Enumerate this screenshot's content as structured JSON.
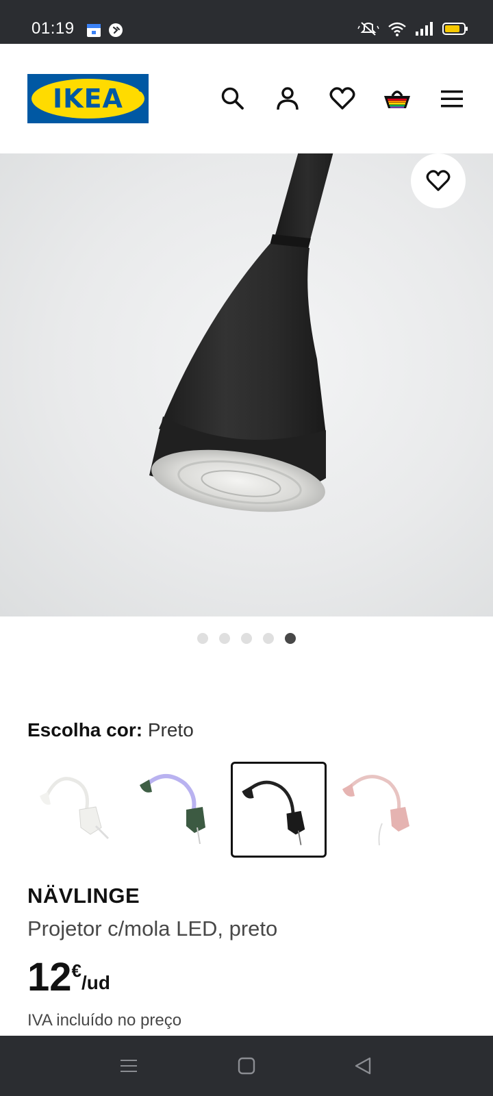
{
  "status_bar": {
    "time": "01:19",
    "icons": [
      "calendar-icon",
      "shazam-icon",
      "mute-icon",
      "wifi-icon",
      "signal-icon",
      "battery-icon"
    ],
    "battery_color": "#f7c900",
    "battery_level": 0.8
  },
  "header": {
    "logo_text": "IKEA",
    "brand_blue": "#0058a3",
    "brand_yellow": "#ffdb00",
    "icons": [
      "search-icon",
      "account-icon",
      "favorites-icon",
      "cart-icon",
      "menu-icon"
    ]
  },
  "gallery": {
    "image": "black-lamp-closeup",
    "dots_total": 5,
    "active_index": 4
  },
  "color_picker": {
    "label": "Escolha cor:",
    "selected": "Preto",
    "options": [
      "white",
      "green",
      "black",
      "pink"
    ],
    "selected_index": 2
  },
  "product": {
    "name": "NÄVLINGE",
    "description": "Projetor c/mola LED, preto",
    "price_integer": "12",
    "currency": "€",
    "unit": "/ud",
    "vat_note": "IVA incluído no preço"
  },
  "nav_bar": {
    "icons": [
      "recents-icon",
      "home-icon",
      "back-icon"
    ]
  }
}
